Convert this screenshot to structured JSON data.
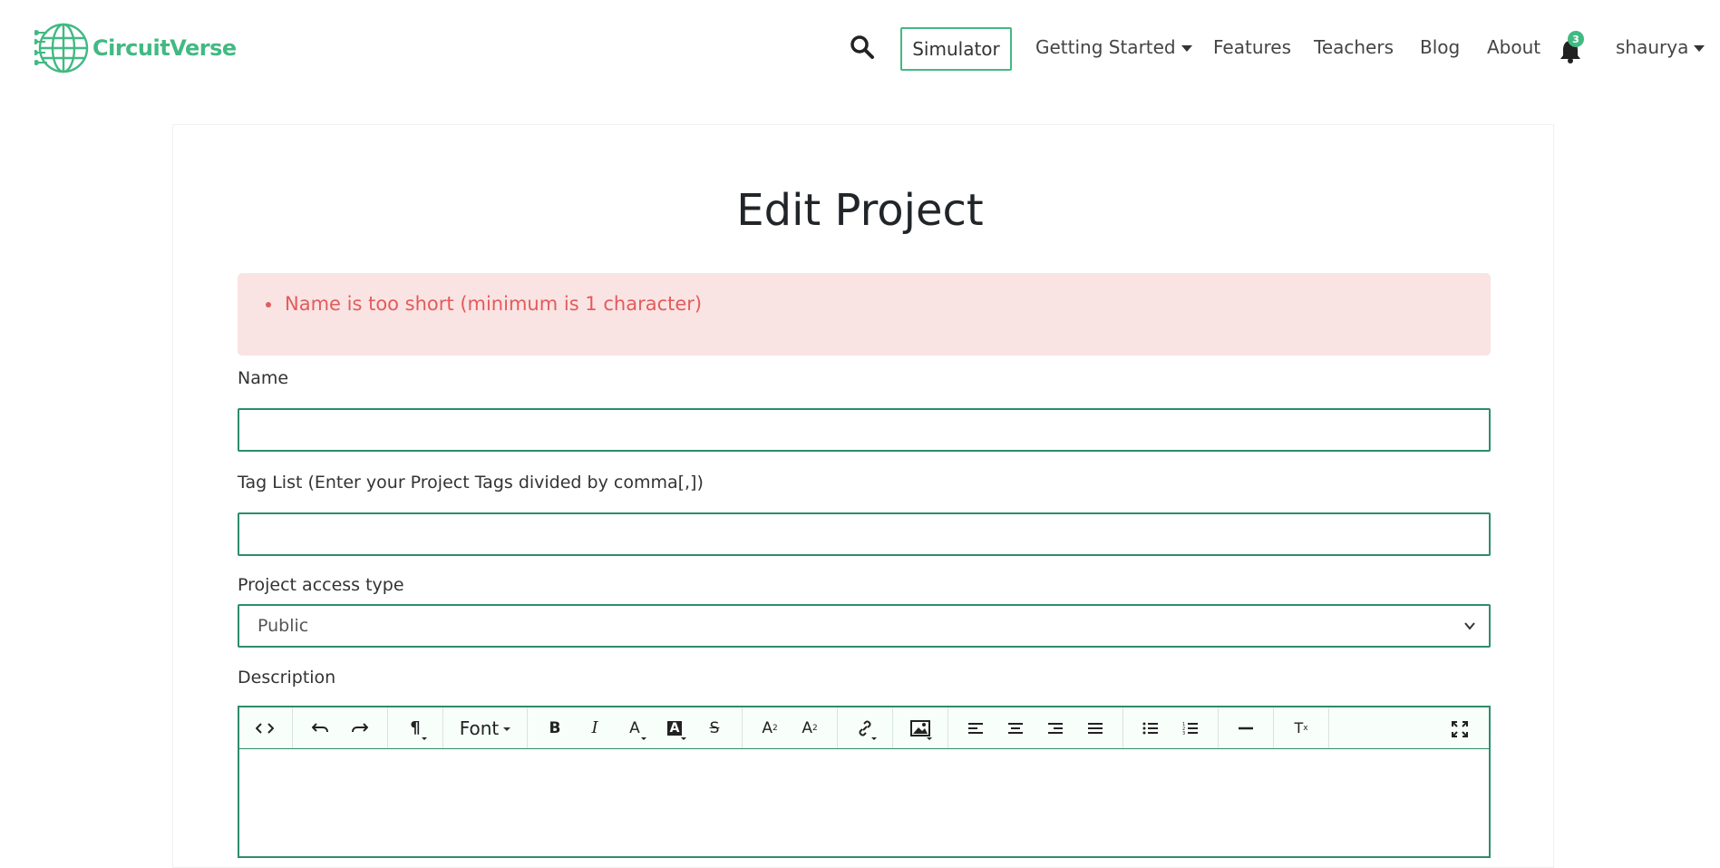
{
  "brand": {
    "name": "CircuitVerse",
    "color": "#42b983"
  },
  "nav": {
    "simulator": "Simulator",
    "getting_started": "Getting Started",
    "features": "Features",
    "teachers": "Teachers",
    "blog": "Blog",
    "about": "About",
    "notifications_count": "3",
    "user": "shaurya"
  },
  "page": {
    "title": "Edit Project"
  },
  "alert": {
    "errors": [
      "Name is too short (minimum is 1 character)"
    ]
  },
  "form": {
    "name_label": "Name",
    "name_value": "",
    "tags_label": "Tag List (Enter your Project Tags divided by comma[,])",
    "tags_value": "",
    "access_label": "Project access type",
    "access_value": "Public",
    "description_label": "Description"
  },
  "editor": {
    "font_label": "Font",
    "icons": [
      "code-view-icon",
      "undo-icon",
      "redo-icon",
      "paragraph-icon",
      "font-select",
      "bold-icon",
      "italic-icon",
      "font-color-icon",
      "highlight-icon",
      "strikethrough-icon",
      "superscript-icon",
      "subscript-icon",
      "link-icon",
      "image-icon",
      "align-left-icon",
      "align-center-icon",
      "align-right-icon",
      "align-justify-icon",
      "bullet-list-icon",
      "numbered-list-icon",
      "horizontal-rule-icon",
      "clear-format-icon",
      "fullscreen-icon"
    ]
  },
  "colors": {
    "accent": "#42b983",
    "border": "#2d8d6a",
    "alert_bg": "#fae3e3",
    "alert_text": "#e35b5b"
  }
}
